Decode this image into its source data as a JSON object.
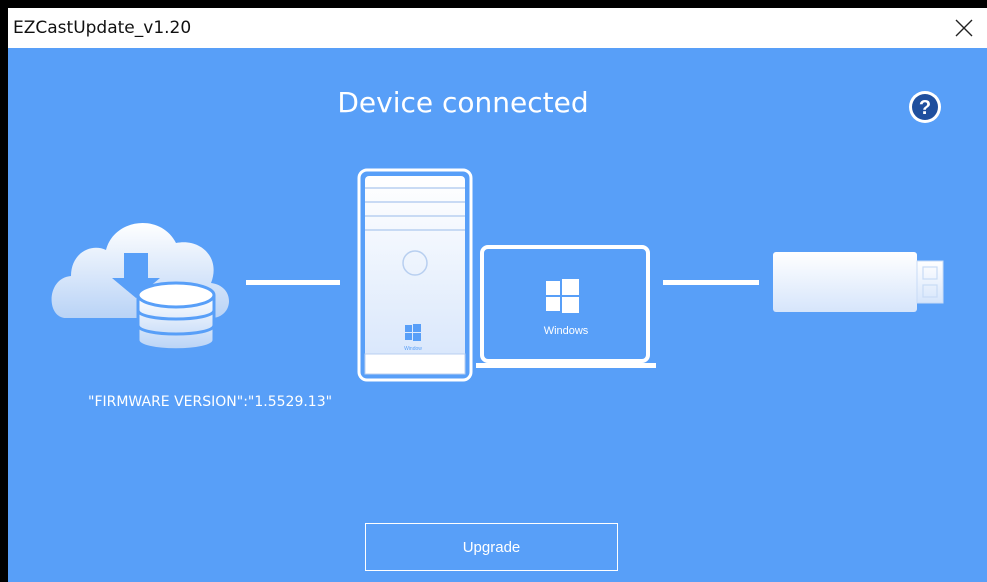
{
  "window": {
    "title": "EZCastUpdate_v1.20"
  },
  "main": {
    "heading": "Device connected",
    "firmware_text": "\"FIRMWARE VERSION\":\"1.5529.13\"",
    "upgrade_label": "Upgrade"
  },
  "devices": {
    "tower_os_label": "Window",
    "laptop_os_label": "Windows"
  },
  "icons": [
    "close-icon",
    "help-icon",
    "cloud-database-icon",
    "desktop-tower-icon",
    "laptop-icon",
    "usb-dongle-icon"
  ],
  "colors": {
    "background": "#589ff8",
    "foreground": "#ffffff",
    "window_border": "#000000"
  }
}
